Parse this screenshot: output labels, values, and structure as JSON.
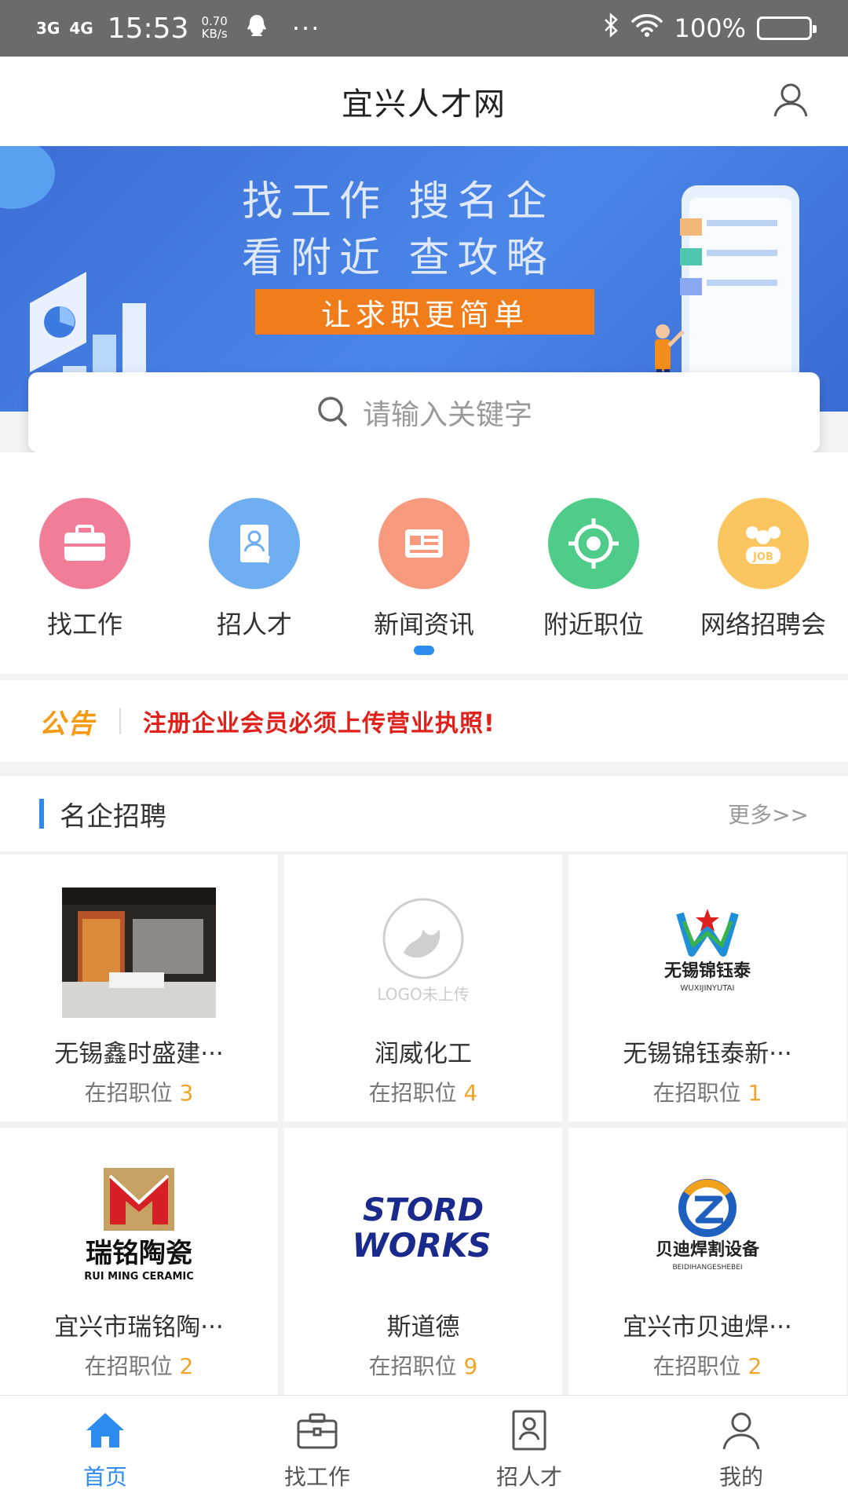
{
  "status_bar": {
    "network1": "3G",
    "network2": "4G",
    "time": "15:53",
    "speed_value": "0.70",
    "speed_unit": "KB/s",
    "dots": "···",
    "battery": "100%"
  },
  "header": {
    "title": "宜兴人才网"
  },
  "banner": {
    "line1": "找工作 搜名企",
    "line2": "看附近 查攻略",
    "slogan": "让求职更简单"
  },
  "search": {
    "placeholder": "请输入关键字"
  },
  "categories": [
    {
      "label": "找工作",
      "icon": "briefcase-icon",
      "color": "#f27d98"
    },
    {
      "label": "招人才",
      "icon": "resume-icon",
      "color": "#6faef0"
    },
    {
      "label": "新闻资讯",
      "icon": "news-icon",
      "color": "#f79a7d"
    },
    {
      "label": "附近职位",
      "icon": "location-target-icon",
      "color": "#4fcb8a"
    },
    {
      "label": "网络招聘会",
      "icon": "job-fair-icon",
      "color": "#fbc55f"
    }
  ],
  "notice": {
    "badge": "公告",
    "text": "注册企业会员必须上传营业执照!"
  },
  "section": {
    "title": "名企招聘",
    "more": "更多>>"
  },
  "companies": [
    {
      "name": "无锡鑫时盛建···",
      "jobs_label": "在招职位",
      "jobs": "3",
      "logo": "store-photo"
    },
    {
      "name": "润威化工",
      "jobs_label": "在招职位",
      "jobs": "4",
      "logo": "logo-placeholder",
      "logo_text": "LOGO未上传"
    },
    {
      "name": "无锡锦钰泰新···",
      "jobs_label": "在招职位",
      "jobs": "1",
      "logo": "wuxi-jinyutai-logo",
      "logo_text": "无锡锦钰泰",
      "logo_sub": "WUXIJINYUTAI"
    },
    {
      "name": "宜兴市瑞铭陶···",
      "jobs_label": "在招职位",
      "jobs": "2",
      "logo": "ruiming-ceramic-logo",
      "logo_text": "瑞铭陶瓷",
      "logo_sub": "RUI MING CERAMIC"
    },
    {
      "name": "斯道德",
      "jobs_label": "在招职位",
      "jobs": "9",
      "logo": "stord-works-logo",
      "logo_text": "STORD",
      "logo_sub": "WORKS"
    },
    {
      "name": "宜兴市贝迪焊···",
      "jobs_label": "在招职位",
      "jobs": "2",
      "logo": "beidi-logo",
      "logo_text": "贝迪焊割设备",
      "logo_sub": "BEIDIHANGESHEBEI"
    }
  ],
  "tabbar": [
    {
      "label": "首页",
      "icon": "home-icon",
      "active": true
    },
    {
      "label": "找工作",
      "icon": "briefcase-icon",
      "active": false
    },
    {
      "label": "招人才",
      "icon": "resume-icon",
      "active": false
    },
    {
      "label": "我的",
      "icon": "user-icon",
      "active": false
    }
  ],
  "colors": {
    "accent": "#2d8cf0",
    "notice_red": "#e0201a",
    "notice_orange": "#f59a12",
    "slogan_orange": "#f07c1a",
    "job_count": "#f0a528"
  }
}
